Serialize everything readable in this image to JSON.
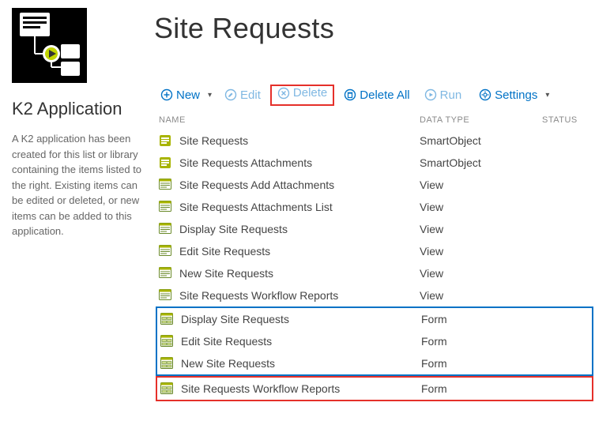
{
  "sidebar": {
    "title": "K2 Application",
    "description": "A K2 application has been created for this list or library containing the items listed to the right. Existing items can be edited or deleted, or new items can be added to this application."
  },
  "header": {
    "title": "Site Requests"
  },
  "toolbar": {
    "new_label": "New",
    "edit_label": "Edit",
    "delete_label": "Delete",
    "deleteall_label": "Delete All",
    "run_label": "Run",
    "settings_label": "Settings"
  },
  "columns": {
    "name": "NAME",
    "datatype": "DATA TYPE",
    "status": "STATUS"
  },
  "items": [
    {
      "name": "Site Requests",
      "type": "SmartObject",
      "icon": "smartobject"
    },
    {
      "name": "Site Requests Attachments",
      "type": "SmartObject",
      "icon": "smartobject"
    },
    {
      "name": "Site Requests Add Attachments",
      "type": "View",
      "icon": "view"
    },
    {
      "name": "Site Requests Attachments List",
      "type": "View",
      "icon": "view"
    },
    {
      "name": "Display Site Requests",
      "type": "View",
      "icon": "view"
    },
    {
      "name": "Edit Site Requests",
      "type": "View",
      "icon": "view"
    },
    {
      "name": "New Site Requests",
      "type": "View",
      "icon": "view"
    },
    {
      "name": "Site Requests Workflow Reports",
      "type": "View",
      "icon": "view"
    },
    {
      "name": "Display Site Requests",
      "type": "Form",
      "icon": "form"
    },
    {
      "name": "Edit Site Requests",
      "type": "Form",
      "icon": "form"
    },
    {
      "name": "New Site Requests",
      "type": "Form",
      "icon": "form"
    },
    {
      "name": "Site Requests Workflow Reports",
      "type": "Form",
      "icon": "form"
    }
  ]
}
